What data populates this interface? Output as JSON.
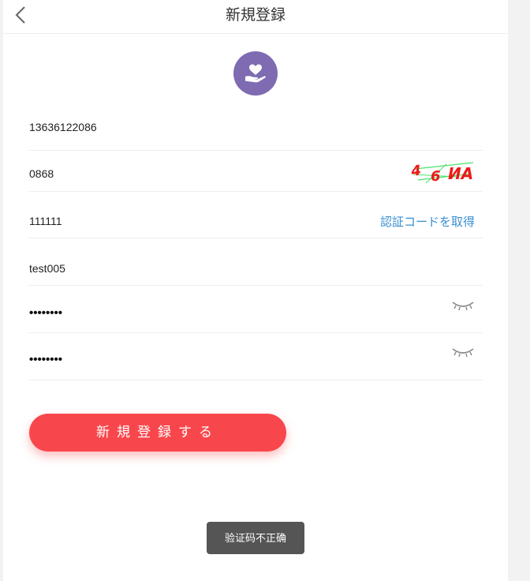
{
  "header": {
    "title": "新規登録"
  },
  "form": {
    "phone": "13636122086",
    "captcha_input": "0868",
    "captcha_image_text": "4 6 ИA",
    "sms_code": "111111",
    "get_code_label": "認証コードを取得",
    "username": "test005",
    "password": "••••••••",
    "password_confirm": "••••••••"
  },
  "submit": {
    "label": "新規登録する"
  },
  "toast": {
    "message": "验证码不正确"
  },
  "colors": {
    "accent": "#f8474c",
    "logo_bg": "#7e6bb2",
    "link": "#3a8fd0",
    "toast_bg": "#555555"
  },
  "icons": {
    "back": "chevron-left-icon",
    "logo": "heart-hand-icon",
    "password_toggle": "eye-closed-icon"
  }
}
